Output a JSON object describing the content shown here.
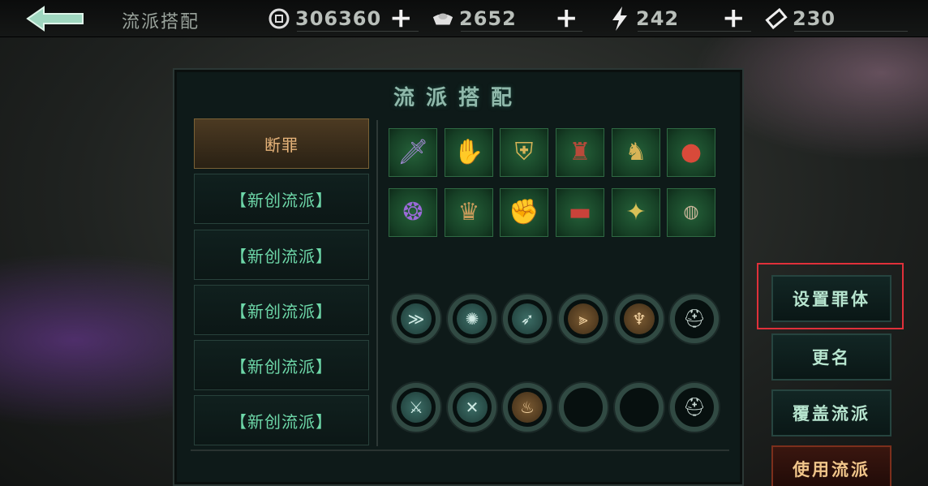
{
  "header": {
    "title": "流派搭配",
    "resources": [
      {
        "icon": "coin-icon",
        "value": "306360"
      },
      {
        "icon": "ingot-icon",
        "value": "2652"
      },
      {
        "icon": "lightning-icon",
        "value": "242"
      },
      {
        "icon": "ticket-icon",
        "value": "230"
      }
    ]
  },
  "panel": {
    "title": "流派搭配",
    "builds": [
      {
        "label": "断罪",
        "active": true
      },
      {
        "label": "【新创流派】"
      },
      {
        "label": "【新创流派】"
      },
      {
        "label": "【新创流派】"
      },
      {
        "label": "【新创流派】"
      },
      {
        "label": "【新创流派】"
      }
    ],
    "equipment_slots": [
      "spear-icon",
      "gauntlet-icon",
      "armor-icon",
      "cloak-icon",
      "leg-armor-icon",
      "orb-icon",
      "amulet-icon",
      "robe-icon",
      "bracer-icon",
      "belt-icon",
      "charm-icon",
      "ring-icon"
    ],
    "skill_slots_row1": [
      "claw-skill-icon",
      "wind-skill-icon",
      "dash-skill-icon",
      "slash-skill-icon",
      "spike-skill-icon",
      "mask-icon"
    ],
    "skill_slots_row2": [
      "sword-skill-icon",
      "cross-skill-icon",
      "flame-skill-icon",
      "empty-slot",
      "empty-slot",
      "mask-icon"
    ]
  },
  "actions": {
    "set_body": "设置罪体",
    "rename": "更名",
    "overwrite": "覆盖流派",
    "use": "使用流派"
  }
}
